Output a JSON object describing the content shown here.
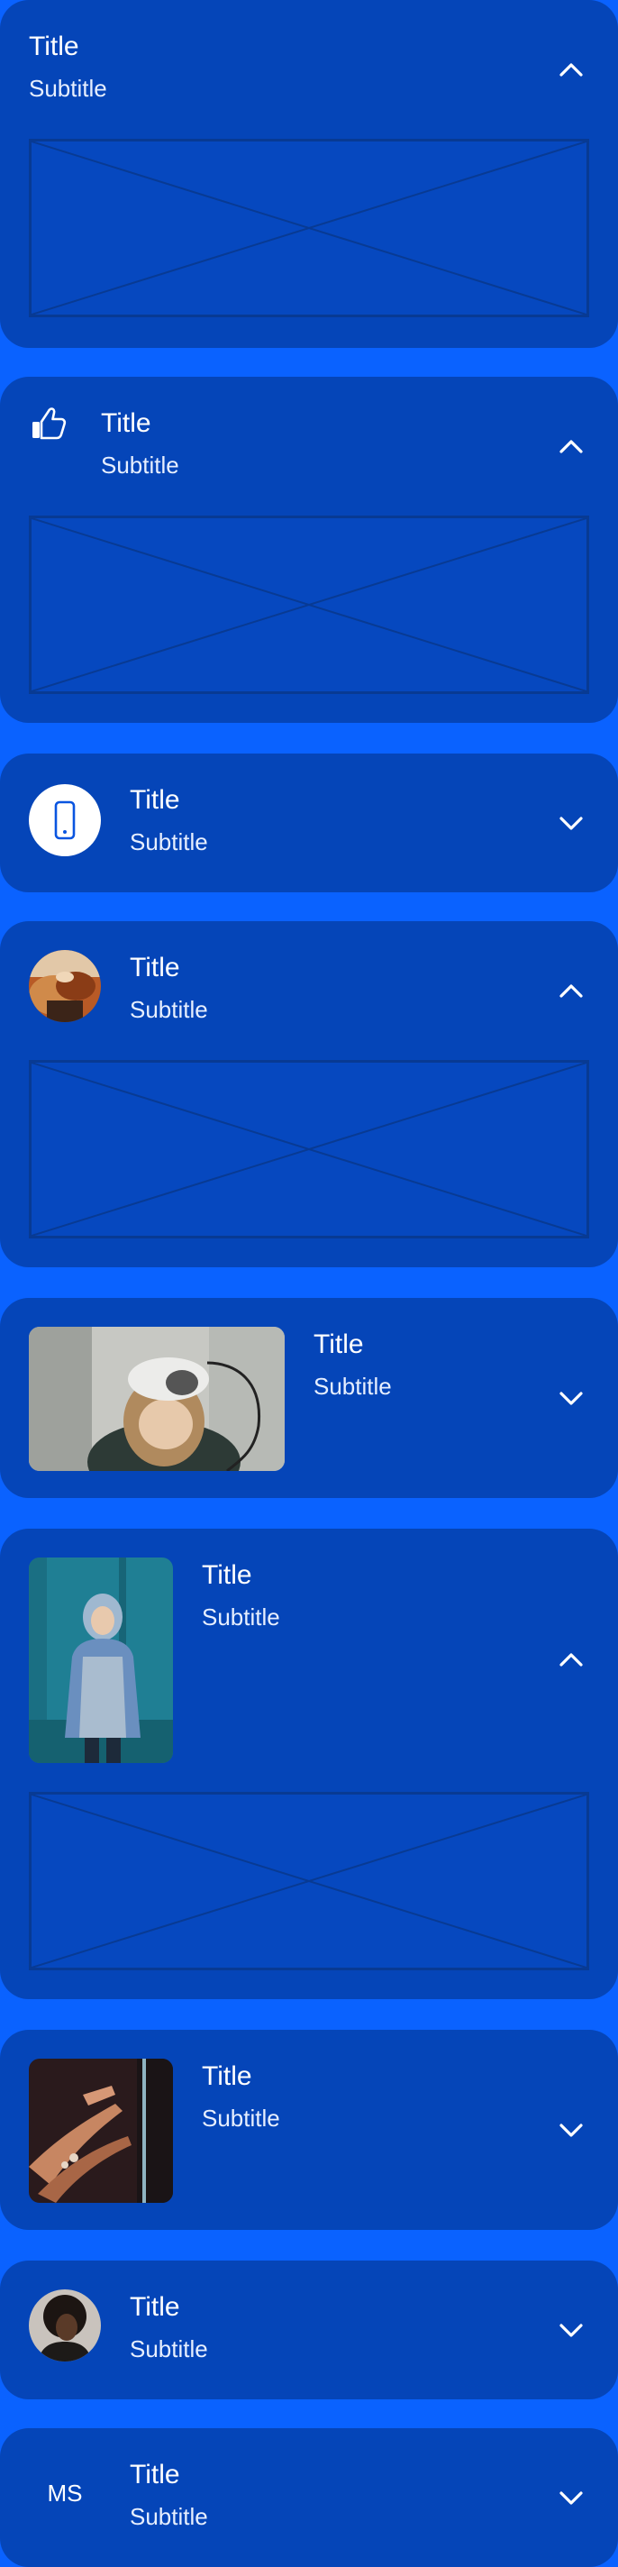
{
  "colors": {
    "background": "#0a62ff",
    "card": "#0545b8",
    "placeholder_stroke": "#083a93",
    "text": "#ffffff"
  },
  "items": [
    {
      "title": "Title",
      "subtitle": "Subtitle",
      "leading": "none",
      "state": "expanded",
      "chevron": "chevron-up-icon"
    },
    {
      "title": "Title",
      "subtitle": "Subtitle",
      "leading": "thumbs-up-icon",
      "state": "expanded",
      "chevron": "chevron-up-icon"
    },
    {
      "title": "Title",
      "subtitle": "Subtitle",
      "leading": "smartphone-icon",
      "state": "collapsed",
      "chevron": "chevron-down-icon"
    },
    {
      "title": "Title",
      "subtitle": "Subtitle",
      "leading": "round-photo",
      "state": "expanded",
      "chevron": "chevron-up-icon"
    },
    {
      "title": "Title",
      "subtitle": "Subtitle",
      "leading": "wide-photo-vr-headset",
      "state": "collapsed",
      "chevron": "chevron-down-icon"
    },
    {
      "title": "Title",
      "subtitle": "Subtitle",
      "leading": "tall-photo-person-hoodie",
      "state": "expanded",
      "chevron": "chevron-up-icon"
    },
    {
      "title": "Title",
      "subtitle": "Subtitle",
      "leading": "square-photo-hands",
      "state": "collapsed",
      "chevron": "chevron-down-icon"
    },
    {
      "title": "Title",
      "subtitle": "Subtitle",
      "leading": "avatar-photo",
      "state": "collapsed",
      "chevron": "chevron-down-icon"
    },
    {
      "title": "Title",
      "subtitle": "Subtitle",
      "leading": "initials",
      "initials": "MS",
      "state": "collapsed",
      "chevron": "chevron-down-icon"
    }
  ]
}
